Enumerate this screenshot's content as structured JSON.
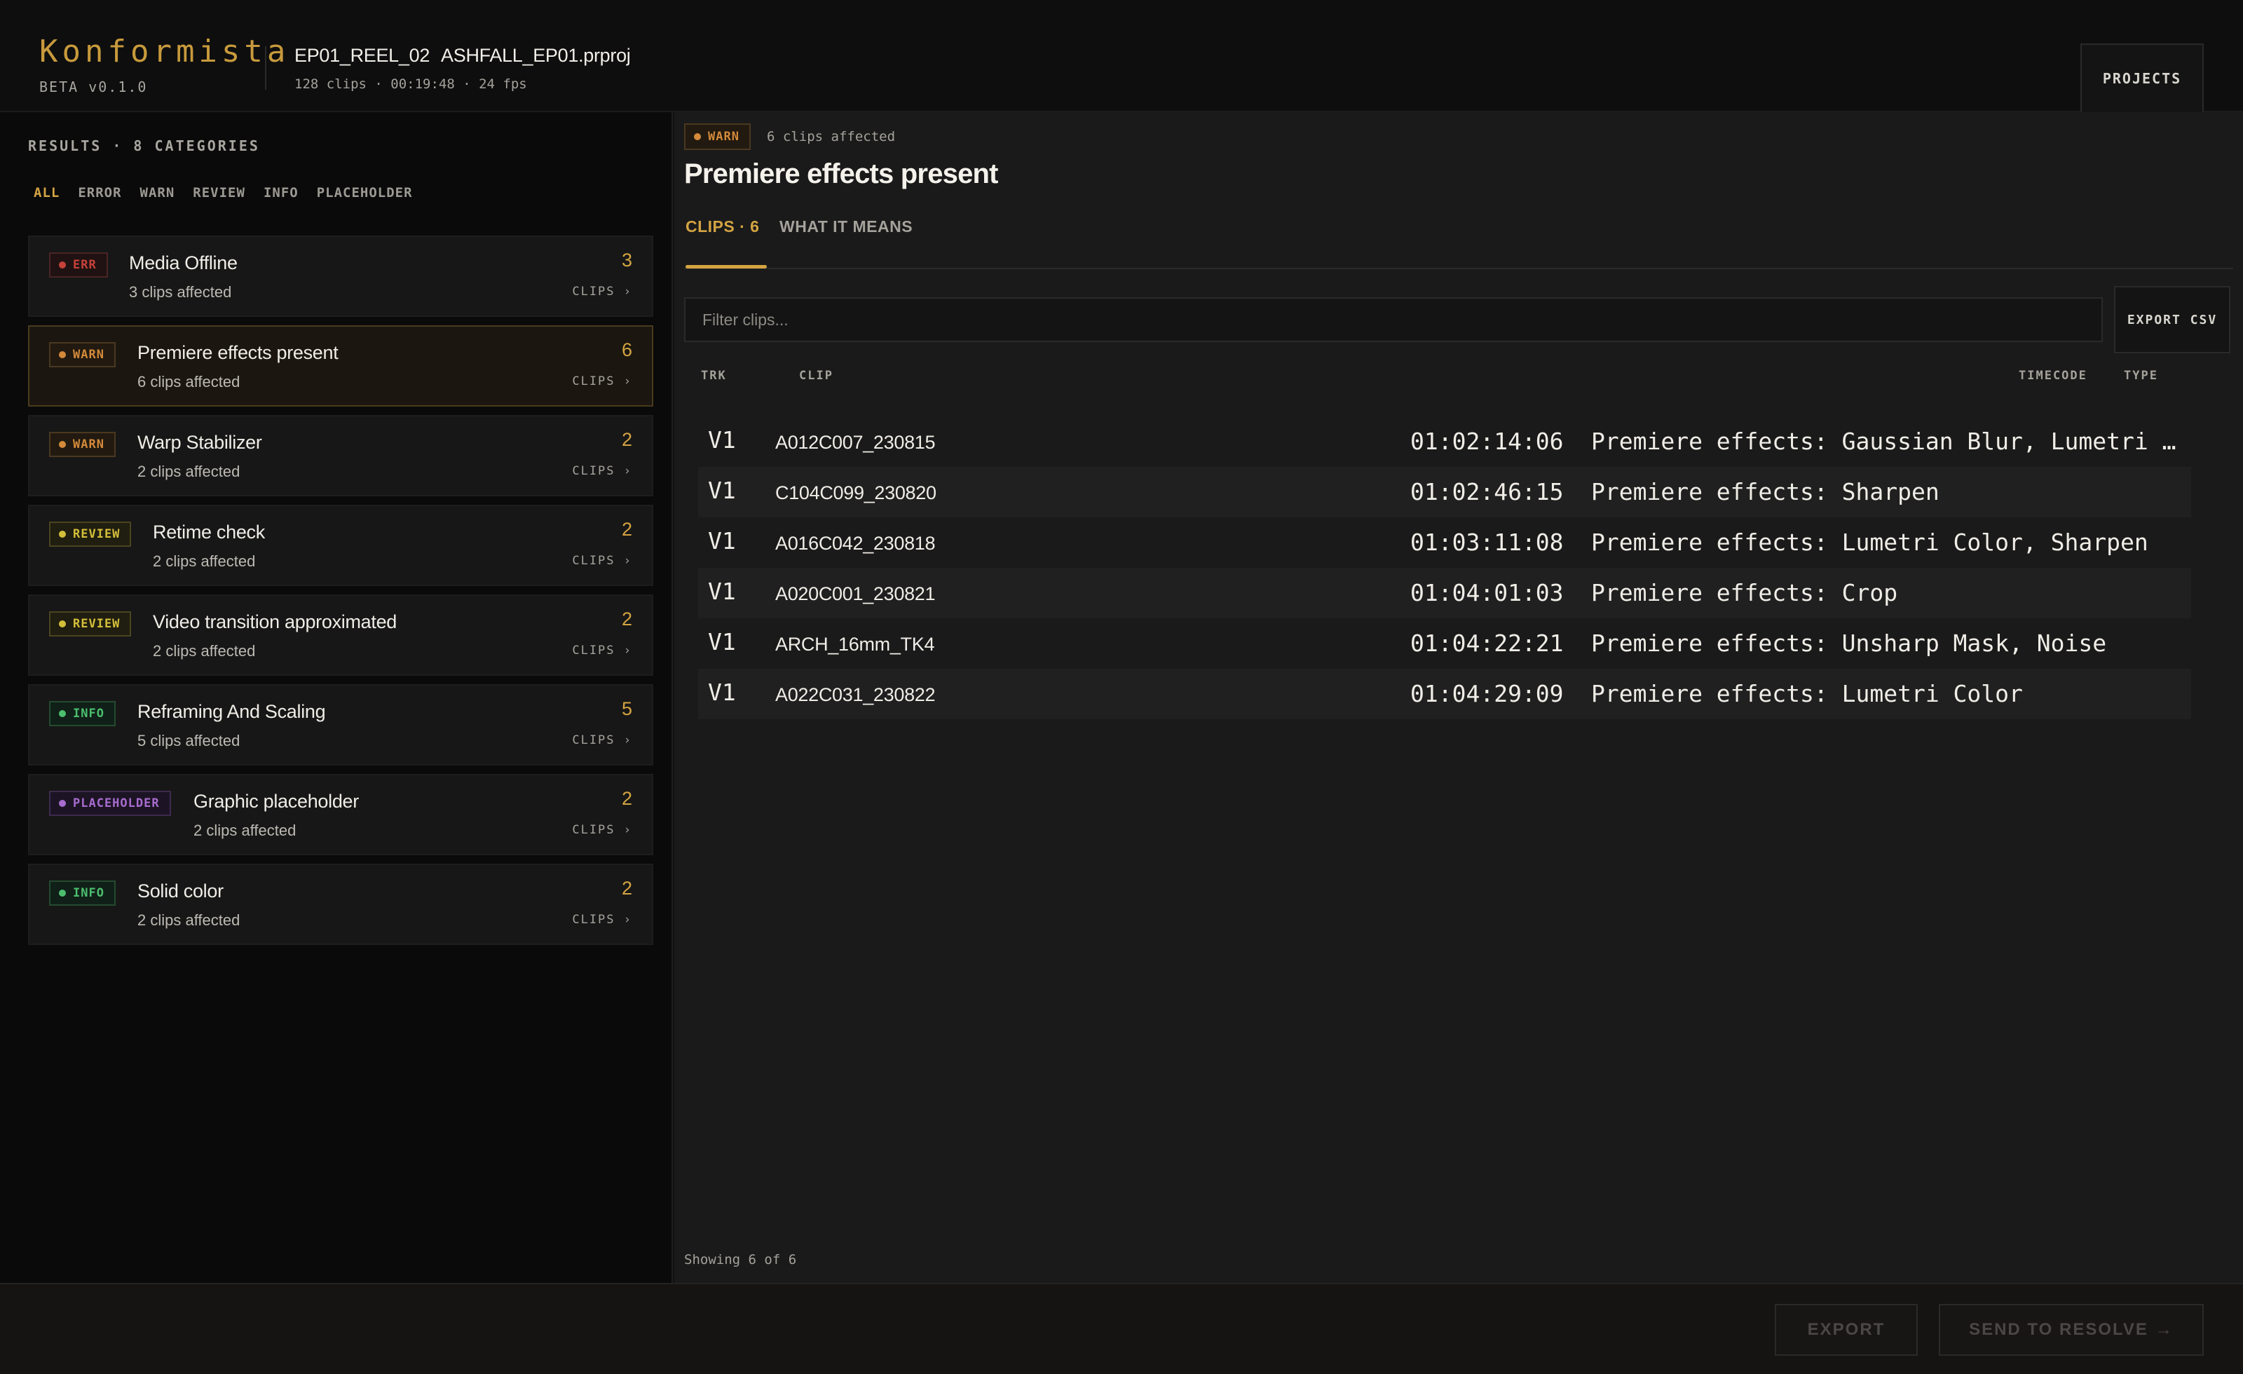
{
  "header": {
    "brand": "Konformista",
    "version": "BETA v0.1.0",
    "project_reel": "EP01_REEL_02",
    "project_file": "ASHFALL_EP01.prproj",
    "project_meta": "128 clips · 00:19:48 · 24 fps",
    "projects_button": "PROJECTS"
  },
  "sidebar": {
    "heading": "RESULTS · 8 CATEGORIES",
    "filters": [
      "ALL",
      "ERROR",
      "WARN",
      "REVIEW",
      "INFO",
      "PLACEHOLDER"
    ],
    "active_filter": "ALL",
    "categories": [
      {
        "badge": "ERR",
        "severity": "err",
        "name": "Media Offline",
        "sub": "3 clips affected",
        "count": "3",
        "clips_label": "CLIPS ›"
      },
      {
        "badge": "WARN",
        "severity": "warn",
        "name": "Premiere effects present",
        "sub": "6 clips affected",
        "count": "6",
        "clips_label": "CLIPS ›",
        "selected": true
      },
      {
        "badge": "WARN",
        "severity": "warn",
        "name": "Warp Stabilizer",
        "sub": "2 clips affected",
        "count": "2",
        "clips_label": "CLIPS ›"
      },
      {
        "badge": "REVIEW",
        "severity": "review",
        "name": "Retime check",
        "sub": "2 clips affected",
        "count": "2",
        "clips_label": "CLIPS ›"
      },
      {
        "badge": "REVIEW",
        "severity": "review",
        "name": "Video transition approximated",
        "sub": "2 clips affected",
        "count": "2",
        "clips_label": "CLIPS ›"
      },
      {
        "badge": "INFO",
        "severity": "info",
        "name": "Reframing And Scaling",
        "sub": "5 clips affected",
        "count": "5",
        "clips_label": "CLIPS ›"
      },
      {
        "badge": "PLACEHOLDER",
        "severity": "placeholder",
        "name": "Graphic placeholder",
        "sub": "2 clips affected",
        "count": "2",
        "clips_label": "CLIPS ›"
      },
      {
        "badge": "INFO",
        "severity": "info",
        "name": "Solid color",
        "sub": "2 clips affected",
        "count": "2",
        "clips_label": "CLIPS ›"
      }
    ]
  },
  "main": {
    "badge": "WARN",
    "affected": "6 clips affected",
    "title": "Premiere effects present",
    "tabs": [
      {
        "label": "CLIPS · 6",
        "active": true
      },
      {
        "label": "WHAT IT MEANS",
        "active": false
      }
    ],
    "filter_placeholder": "Filter clips...",
    "export_csv": "EXPORT CSV",
    "columns": {
      "trk": "TRK",
      "clip": "CLIP",
      "timecode": "TIMECODE",
      "type": "TYPE"
    },
    "rows": [
      {
        "trk": "V1",
        "clip": "A012C007_230815",
        "timecode": "01:02:14:06",
        "type": "Premiere effects: Gaussian Blur, Lumetri …"
      },
      {
        "trk": "V1",
        "clip": "C104C099_230820",
        "timecode": "01:02:46:15",
        "type": "Premiere effects: Sharpen"
      },
      {
        "trk": "V1",
        "clip": "A016C042_230818",
        "timecode": "01:03:11:08",
        "type": "Premiere effects: Lumetri Color, Sharpen"
      },
      {
        "trk": "V1",
        "clip": "A020C001_230821",
        "timecode": "01:04:01:03",
        "type": "Premiere effects: Crop"
      },
      {
        "trk": "V1",
        "clip": "ARCH_16mm_TK4",
        "timecode": "01:04:22:21",
        "type": "Premiere effects: Unsharp Mask, Noise"
      },
      {
        "trk": "V1",
        "clip": "A022C031_230822",
        "timecode": "01:04:29:09",
        "type": "Premiere effects: Lumetri Color"
      }
    ],
    "showing": "Showing 6 of 6"
  },
  "footer": {
    "export": "EXPORT",
    "send_to_resolve": "SEND TO RESOLVE",
    "arrow_icon": "→"
  },
  "colors": {
    "accent": "#d4a442",
    "err": "#c8423a",
    "warn": "#d48a3a",
    "review": "#d4bf3a",
    "info": "#4cbf6e",
    "placeholder": "#a86cd0"
  }
}
